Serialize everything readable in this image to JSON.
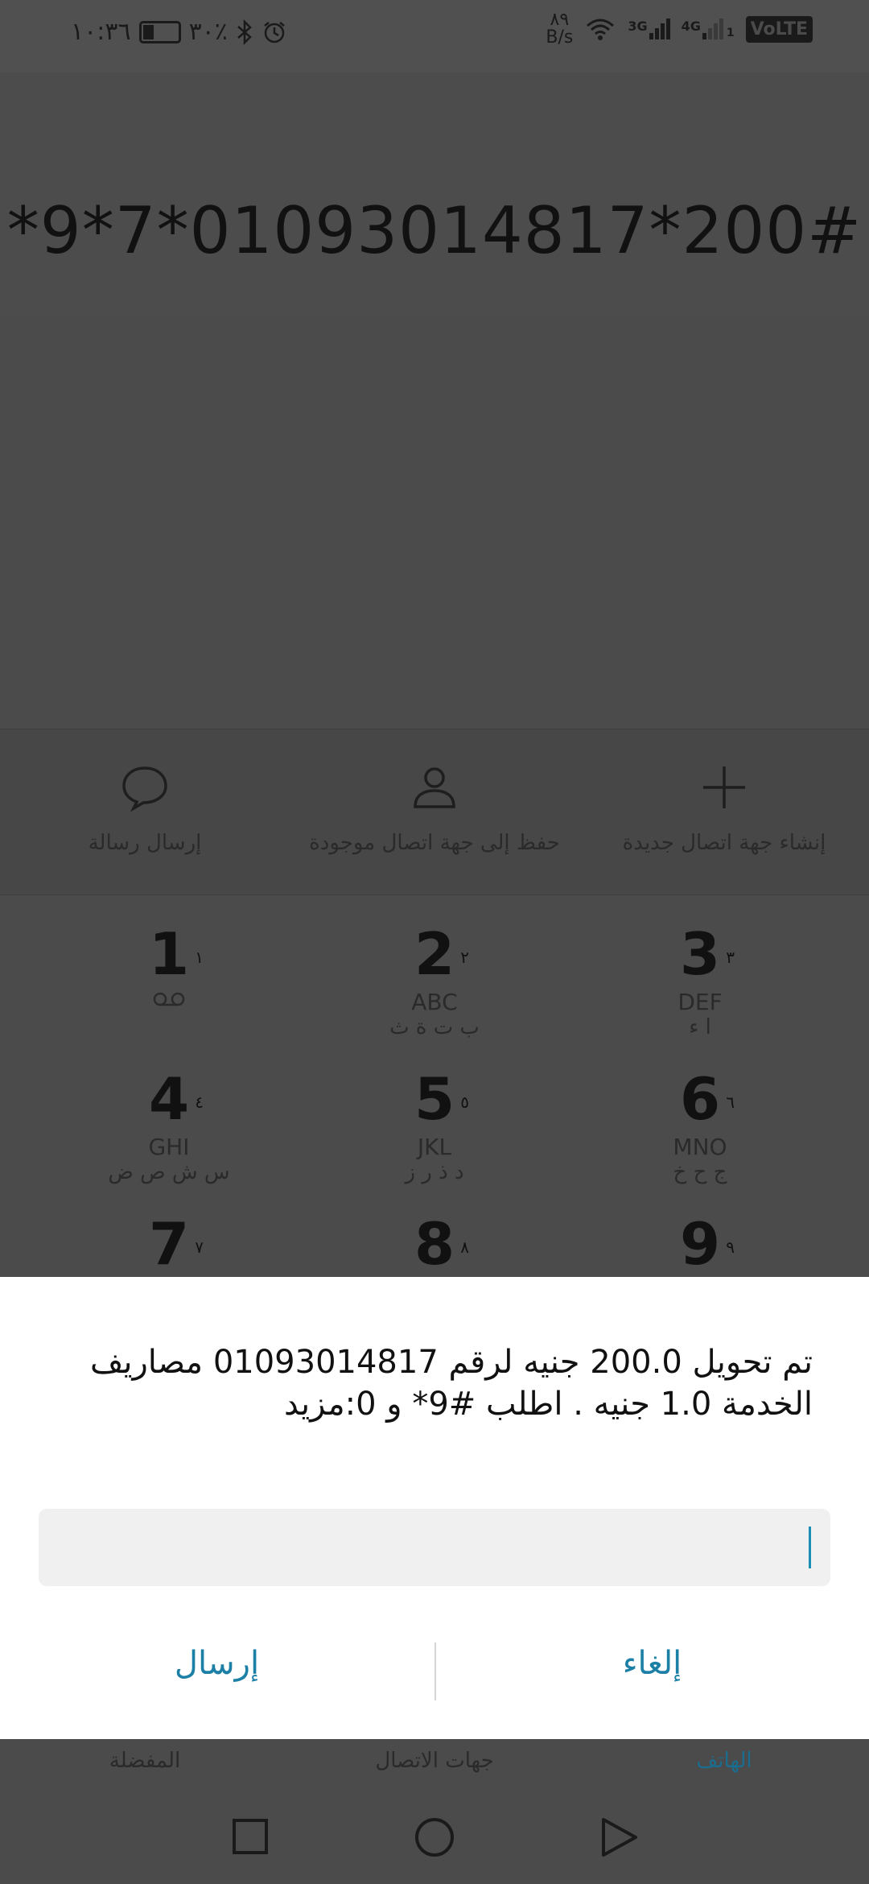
{
  "status_bar": {
    "time": "١٠:٣٦",
    "battery_percent": "٣٠٪",
    "net_speed_value": "٨٩",
    "net_speed_unit": "B/s",
    "signal_1": "3G",
    "signal_2": "4G",
    "volte": "VoLTE"
  },
  "dialer": {
    "dialed_number": "*9*7*01093014817*200#"
  },
  "actions": [
    {
      "label": "إرسال رسالة",
      "icon": "message-icon"
    },
    {
      "label": "حفظ إلى جهة اتصال موجودة",
      "icon": "person-icon"
    },
    {
      "label": "إنشاء جهة اتصال جديدة",
      "icon": "plus-icon"
    }
  ],
  "keypad": [
    {
      "digit": "1",
      "sup": "١",
      "letters": "",
      "arabic": ""
    },
    {
      "digit": "2",
      "sup": "٢",
      "letters": "ABC",
      "arabic": "ب ت ة ث"
    },
    {
      "digit": "3",
      "sup": "٣",
      "letters": "DEF",
      "arabic": "ا ء"
    },
    {
      "digit": "4",
      "sup": "٤",
      "letters": "GHI",
      "arabic": "س ش ص ض"
    },
    {
      "digit": "5",
      "sup": "٥",
      "letters": "JKL",
      "arabic": "د ذ ر ز"
    },
    {
      "digit": "6",
      "sup": "٦",
      "letters": "MNO",
      "arabic": "ج ح خ"
    },
    {
      "digit": "7",
      "sup": "٧",
      "letters": "",
      "arabic": ""
    },
    {
      "digit": "8",
      "sup": "٨",
      "letters": "",
      "arabic": ""
    },
    {
      "digit": "9",
      "sup": "٩",
      "letters": "",
      "arabic": ""
    }
  ],
  "dialog": {
    "message": "تم تحويل 200.0 جنيه لرقم 01093014817 مصاريف الخدمة 1.0 جنيه . اطلب #9* و 0:مزيد",
    "input_value": "",
    "send_label": "إرسال",
    "cancel_label": "إلغاء"
  },
  "tabs": [
    {
      "label": "المفضلة",
      "active": false
    },
    {
      "label": "جهات الاتصال",
      "active": false
    },
    {
      "label": "الهاتف",
      "active": true
    }
  ],
  "colors": {
    "accent": "#1b7fa6",
    "overlay": "#4b4b4b",
    "dialog_bg": "#ffffff"
  }
}
